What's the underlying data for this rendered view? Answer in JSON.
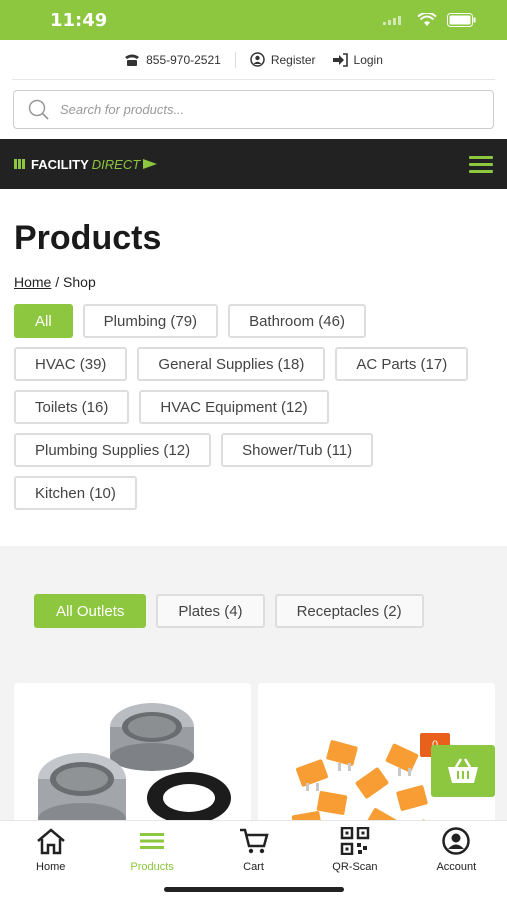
{
  "status": {
    "time": "11:49"
  },
  "topbar": {
    "phone": "855-970-2521",
    "register": "Register",
    "login": "Login"
  },
  "search": {
    "placeholder": "Search for products..."
  },
  "brand": {
    "name_bold": "FACILITY",
    "name_italic": "DIRECT"
  },
  "page": {
    "title": "Products"
  },
  "breadcrumb": {
    "home": "Home",
    "sep": "/",
    "current": "Shop"
  },
  "categories": [
    {
      "label": "All",
      "active": true
    },
    {
      "label": "Plumbing (79)"
    },
    {
      "label": "Bathroom (46)"
    },
    {
      "label": "HVAC (39)"
    },
    {
      "label": "General Supplies (18)"
    },
    {
      "label": "AC Parts (17)"
    },
    {
      "label": "Toilets (16)"
    },
    {
      "label": "HVAC Equipment (12)"
    },
    {
      "label": "Plumbing Supplies (12)"
    },
    {
      "label": "Shower/Tub (11)"
    },
    {
      "label": "Kitchen (10)"
    }
  ],
  "subtabs": [
    {
      "label": "All Outlets",
      "active": true
    },
    {
      "label": "Plates (4)"
    },
    {
      "label": "Receptacles (2)"
    }
  ],
  "cart": {
    "count": "0"
  },
  "bottom_nav": [
    {
      "label": "Home",
      "icon": "home-icon"
    },
    {
      "label": "Products",
      "icon": "menu-icon",
      "active": true
    },
    {
      "label": "Cart",
      "icon": "cart-icon"
    },
    {
      "label": "QR-Scan",
      "icon": "qr-icon"
    },
    {
      "label": "Account",
      "icon": "account-icon"
    }
  ],
  "colors": {
    "accent": "#8dc63f",
    "dark": "#222222",
    "badge": "#e8601c"
  }
}
